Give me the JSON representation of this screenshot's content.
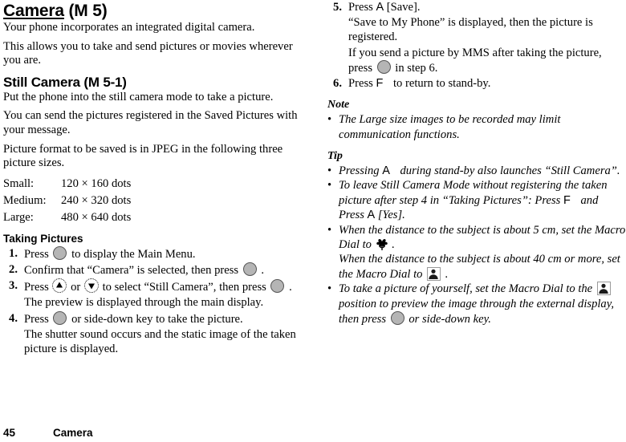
{
  "document": {
    "page_number": "45",
    "chapter": "Camera"
  },
  "left_column": {
    "title_main": "Camera",
    "title_suffix": " (M 5)",
    "intro_1": "Your phone incorporates an integrated digital camera.",
    "intro_2": "This allows you to take and send pictures or movies wherever you are.",
    "subsection_title": "Still Camera (M 5-1)",
    "still_1": "Put the phone into the still camera mode to take a picture.",
    "still_2": "You can send the pictures registered in the Saved Pictures with your message.",
    "still_3": "Picture format to be saved is in JPEG in the following three picture sizes.",
    "sizes": [
      {
        "label": "Small:",
        "value": "120 × 160 dots"
      },
      {
        "label": "Medium:",
        "value": "240 × 320 dots"
      },
      {
        "label": "Large:",
        "value": "480 × 640 dots"
      }
    ],
    "taking_pictures_title": "Taking Pictures",
    "steps": [
      {
        "num": "1.",
        "pre": "Press ",
        "post": " to display the Main Menu.",
        "sub": ""
      },
      {
        "num": "2.",
        "pre": "Confirm that “Camera” is selected, then press ",
        "post": " .",
        "sub": ""
      },
      {
        "num": "3.",
        "pre": "Press ",
        "mid": " or ",
        "post": " to select “Still Camera”, then press ",
        "tail": " .",
        "sub": "The preview is displayed through the main display."
      },
      {
        "num": "4.",
        "pre": "Press ",
        "post": " or side-down key to take the picture.",
        "sub": "The shutter sound occurs and the static image of the taken picture is displayed."
      }
    ]
  },
  "right_column": {
    "steps": [
      {
        "num": "5.",
        "pre": "Press ",
        "key": "A",
        "post": " [Save].",
        "sub_a": "“Save to My Phone” is displayed, then the picture is registered.",
        "sub_b_pre": "If you send a picture by MMS after taking the picture, press ",
        "sub_b_post": " in step 6."
      },
      {
        "num": "6.",
        "pre": "Press ",
        "key": "F",
        "post": " to return to stand-by."
      }
    ],
    "note_title": "Note",
    "note_bullets": [
      "The Large size images to be recorded may limit communication functions."
    ],
    "tip_title": "Tip",
    "tip_bullets": [
      {
        "pre": "Pressing ",
        "key": "A",
        "post": " during stand-by also launches “Still Camera”."
      },
      {
        "pre": "To leave Still Camera Mode without registering the taken picture after step 4 in “Taking Pictures”: Press ",
        "key": "F",
        "mid": " and Press ",
        "key2": "A",
        "post": " [Yes]."
      },
      {
        "pre": "When the distance to the subject is about 5 cm, set the Macro Dial to ",
        "post": " .",
        "line2_pre": "When the distance to the subject is about 40 cm or more, set the Macro Dial to ",
        "line2_post": " ."
      },
      {
        "pre": "To take a picture of yourself, set the Macro Dial to the ",
        "mid": " position to preview the image through the external display, then press ",
        "post": " or side-down key."
      }
    ]
  },
  "icons": {
    "center_key": "center-select-key-icon",
    "nav_up": "nav-up-key-icon",
    "nav_down": "nav-down-key-icon",
    "macro": "macro-flower-icon",
    "portrait": "portrait-person-icon",
    "left_softkey": "left-softkey-A-icon",
    "end_key": "end-key-F-icon"
  }
}
